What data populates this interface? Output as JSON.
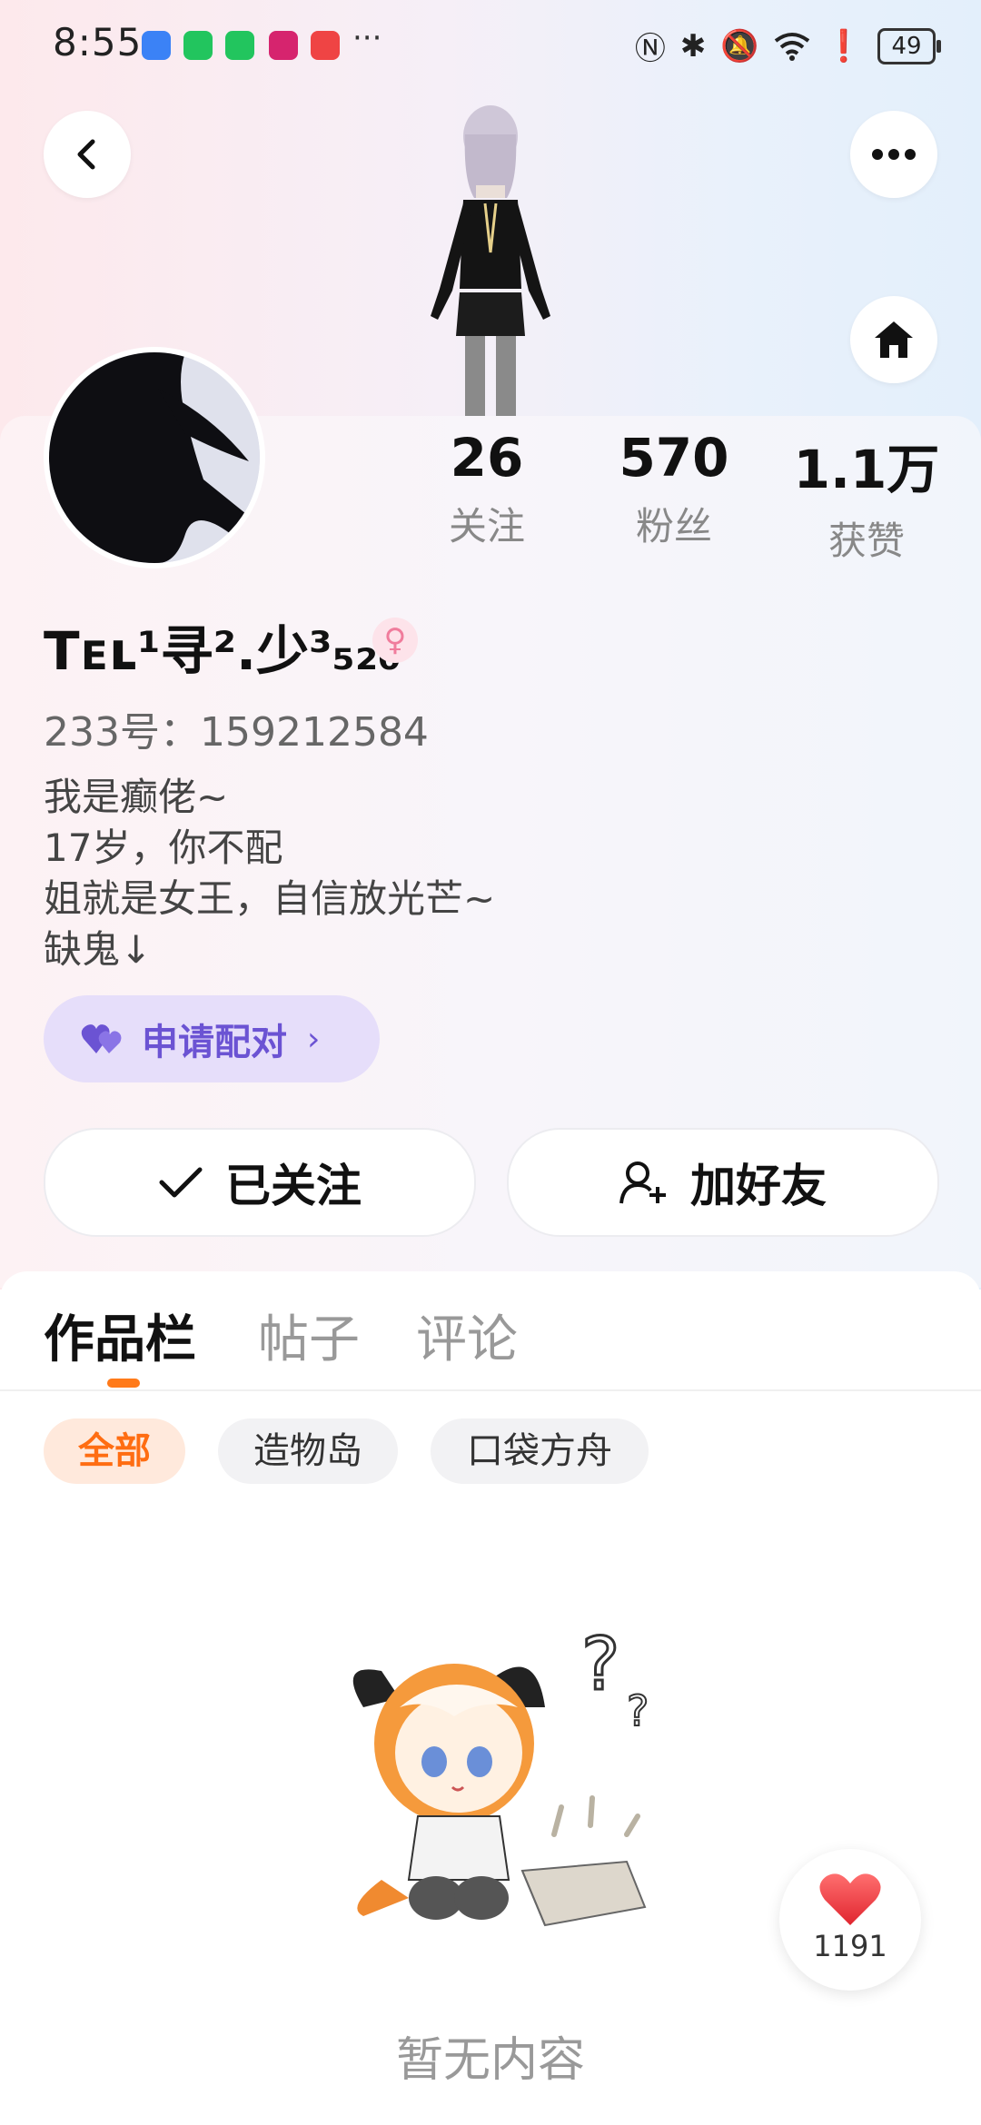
{
  "status_bar": {
    "time": "8:55",
    "battery": "49",
    "more": "···"
  },
  "header": {
    "back_icon": "chevron-left-icon",
    "more_icon": "more-dots-icon",
    "home_icon": "home-icon"
  },
  "profile": {
    "nickname": "Tᴇʟ¹寻².少³₅₂₀",
    "gender_symbol": "♀",
    "uid": "233号：159212584",
    "bio": [
      "我是癫佬~",
      "17岁，你不配",
      "姐就是女王，自信放光芒~",
      "缺鬼↓"
    ],
    "stats": [
      {
        "value": "26",
        "label": "关注"
      },
      {
        "value": "570",
        "label": "粉丝"
      },
      {
        "value": "1.1万",
        "label": "获赞"
      }
    ],
    "pair_button": "申请配对",
    "follow_button": "已关注",
    "add_friend_button": "加好友"
  },
  "tabs": [
    "作品栏",
    "帖子",
    "评论"
  ],
  "filters": [
    "全部",
    "造物岛",
    "口袋方舟"
  ],
  "empty_text": "暂无内容",
  "like_fab": {
    "count": "1191"
  },
  "colors": {
    "accent": "#ff7a1a",
    "pair": "#6b53d3",
    "heart": "#f24a4a"
  }
}
